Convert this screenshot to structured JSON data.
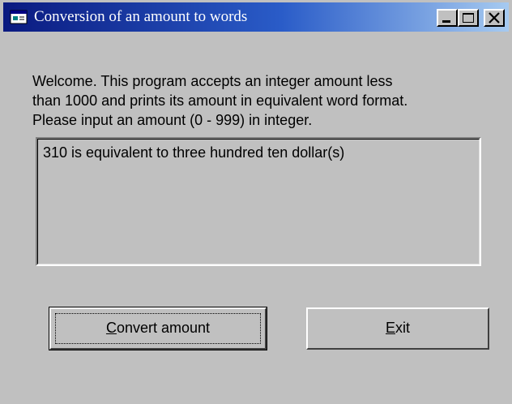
{
  "window": {
    "title": "Conversion of an amount to words",
    "icon": "app-window-icon",
    "controls": {
      "minimize_icon": "minimize-icon",
      "maximize_icon": "maximize-icon",
      "close_icon": "close-icon"
    }
  },
  "message": {
    "line1": "Welcome.  This program accepts an integer amount less",
    "line2": "than 1000 and prints its amount in equivalent word format.",
    "line3": "Please input an amount (0 - 999) in integer."
  },
  "output": {
    "text": "310 is equivalent to three hundred ten dollar(s)"
  },
  "buttons": {
    "convert": {
      "accel": "C",
      "rest": "onvert amount"
    },
    "exit": {
      "accel": "E",
      "rest": "xit"
    }
  },
  "colors": {
    "face": "#c0c0c0",
    "title_start": "#0a1a80",
    "title_end": "#a6caf0"
  }
}
